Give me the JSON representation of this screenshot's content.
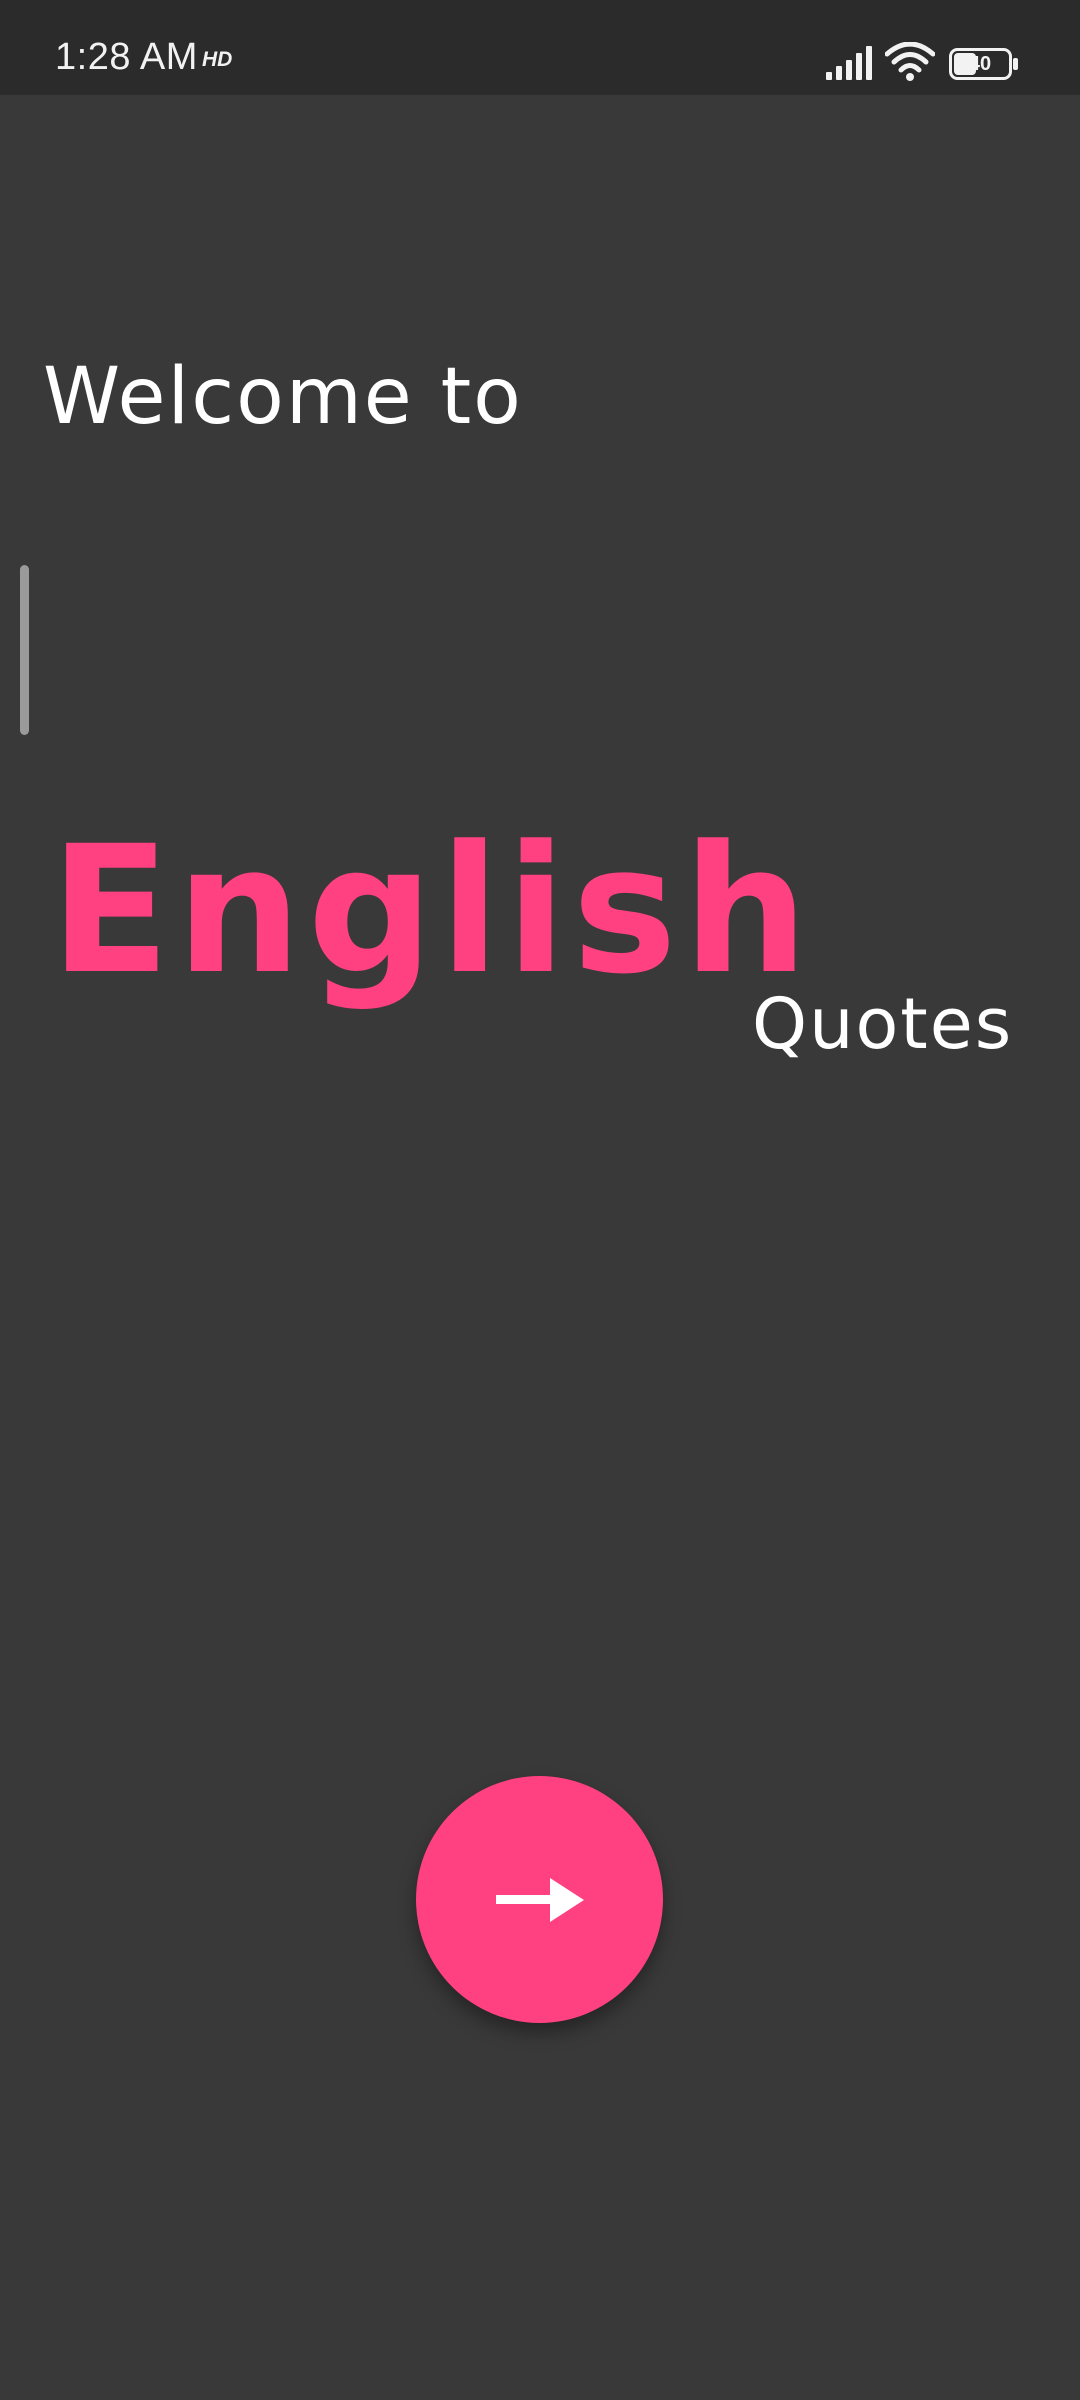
{
  "status_bar": {
    "time": "1:28 AM",
    "hd_badge": "HD",
    "battery_level": "40",
    "icons": [
      "signal-icon",
      "wifi-icon",
      "battery-icon"
    ]
  },
  "welcome": {
    "line1": "Welcome to",
    "app_name": "English",
    "app_suffix": "Quotes"
  },
  "actions": {
    "next_icon": "arrow-right-icon"
  },
  "colors": {
    "background": "#393939",
    "status_bar": "#2b2b2b",
    "accent": "#ff4081",
    "text": "#ffffff"
  }
}
